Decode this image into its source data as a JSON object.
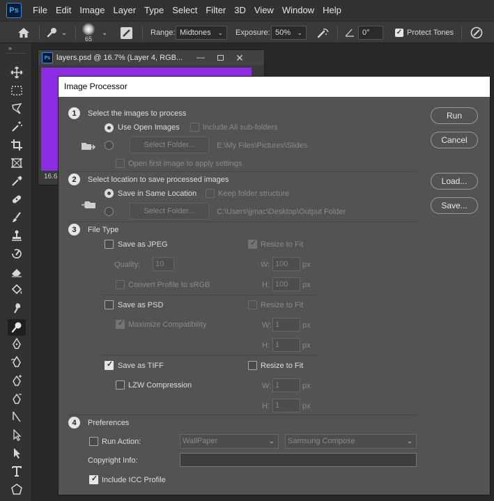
{
  "app": {
    "logo": "Ps"
  },
  "menubar": {
    "items": [
      "File",
      "Edit",
      "Image",
      "Layer",
      "Type",
      "Select",
      "Filter",
      "3D",
      "View",
      "Window",
      "Help"
    ]
  },
  "options_bar": {
    "brush_size": "65",
    "range_label": "Range:",
    "range_value": "Midtones",
    "exposure_label": "Exposure:",
    "exposure_value": "50%",
    "angle_value": "0°",
    "protect_tones_label": "Protect Tones"
  },
  "document": {
    "title": "layers.psd @ 16.7% (Layer 4, RGB...",
    "zoom_readout": "16.6"
  },
  "dialog": {
    "title": "Image Processor",
    "buttons": {
      "run": "Run",
      "cancel": "Cancel",
      "load": "Load...",
      "save": "Save..."
    },
    "section1": {
      "number": "1",
      "title": "Select the images to process",
      "use_open_images": "Use Open Images",
      "include_subfolders": "Include All sub-folders",
      "select_folder": "Select Folder...",
      "folder_path": "E:\\My Files\\Pictures\\Slides",
      "open_first_image": "Open first image to apply settings"
    },
    "section2": {
      "number": "2",
      "title": "Select location to save processed images",
      "save_same_location": "Save in Same Location",
      "keep_folder_structure": "Keep folder structure",
      "select_folder": "Select Folder...",
      "folder_path": "C:\\Users\\jjmac\\Desktop\\Output Folder"
    },
    "section3": {
      "number": "3",
      "title": "File Type",
      "jpeg": {
        "label": "Save as JPEG",
        "resize": "Resize to Fit",
        "quality_label": "Quality:",
        "quality_value": "10",
        "w_label": "W:",
        "w_value": "100",
        "h_label": "H:",
        "h_value": "100",
        "px": "px",
        "convert_profile": "Convert Profile to sRGB"
      },
      "psd": {
        "label": "Save as PSD",
        "resize": "Resize to Fit",
        "maximize": "Maximize Compatibility",
        "w_label": "W:",
        "w_value": "1",
        "h_label": "H:",
        "h_value": "1",
        "px": "px"
      },
      "tiff": {
        "label": "Save as TIFF",
        "resize": "Resize to Fit",
        "lzw": "LZW Compression",
        "w_label": "W:",
        "w_value": "1",
        "h_label": "H:",
        "h_value": "1",
        "px": "px"
      }
    },
    "section4": {
      "number": "4",
      "title": "Preferences",
      "run_action": "Run Action:",
      "action_set": "WallPaper",
      "action_name": "Samsung Compose",
      "copyright_label": "Copyright Info:",
      "copyright_value": "",
      "include_icc": "Include ICC Profile"
    }
  }
}
